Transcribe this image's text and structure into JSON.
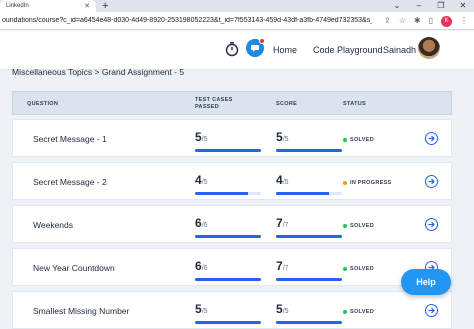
{
  "browser": {
    "tab_title": "LinkedIn",
    "new_tab": "+",
    "url": "oundations/course?c_id=a6454e48-d030-4d49-8920-253198052223&t_id=7f553143-459d-43df-a3fb-4749ed732353&s_i",
    "profile_initial": "K"
  },
  "header": {
    "home_label": "Home",
    "code_label": "Code Playground",
    "user_name": "Sainadh"
  },
  "breadcrumb": "Miscellaneous Topics > Grand Assignment - 5",
  "table": {
    "col_question": "QUESTION",
    "col_tests_line1": "TEST CASES",
    "col_tests_line2": "PASSED",
    "col_score": "SCORE",
    "col_status": "STATUS",
    "rows": [
      {
        "question": "Secret Message - 1",
        "tests_passed": "5",
        "tests_total": "/5",
        "tests_fraction": 1.0,
        "score": "5",
        "score_total": "/5",
        "score_fraction": 1.0,
        "status": "SOLVED",
        "status_color": "#22c55e"
      },
      {
        "question": "Secret Message - 2",
        "tests_passed": "4",
        "tests_total": "/5",
        "tests_fraction": 0.8,
        "score": "4",
        "score_total": "/5",
        "score_fraction": 0.8,
        "status": "IN PROGRESS",
        "status_color": "#f59e0b"
      },
      {
        "question": "Weekends",
        "tests_passed": "6",
        "tests_total": "/6",
        "tests_fraction": 1.0,
        "score": "7",
        "score_total": "/7",
        "score_fraction": 1.0,
        "status": "SOLVED",
        "status_color": "#22c55e"
      },
      {
        "question": "New Year Countdown",
        "tests_passed": "6",
        "tests_total": "/6",
        "tests_fraction": 1.0,
        "score": "7",
        "score_total": "/7",
        "score_fraction": 1.0,
        "status": "SOLVED",
        "status_color": "#22c55e"
      },
      {
        "question": "Smallest Missing Number",
        "tests_passed": "5",
        "tests_total": "/5",
        "tests_fraction": 1.0,
        "score": "5",
        "score_total": "/5",
        "score_fraction": 1.0,
        "status": "SOLVED",
        "status_color": "#22c55e"
      }
    ]
  },
  "help_label": "Help",
  "colors": {
    "accent": "#2563eb",
    "help": "#2196f3"
  }
}
